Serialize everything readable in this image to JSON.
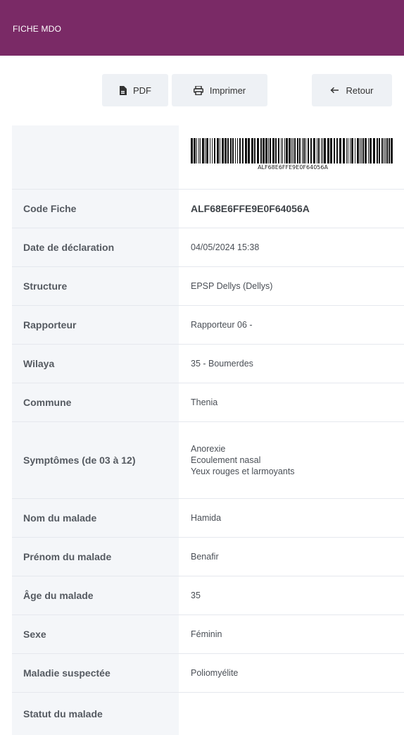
{
  "header": {
    "title": "FICHE MDO"
  },
  "toolbar": {
    "pdf_label": "PDF",
    "print_label": "Imprimer",
    "back_label": "Retour"
  },
  "barcode": {
    "text": "ALF68E6FFE9E0F64056A"
  },
  "fields": [
    {
      "label": "Code Fiche",
      "value": "ALF68E6FFE9E0F64056A"
    },
    {
      "label": "Date de déclaration",
      "value": "04/05/2024 15:38"
    },
    {
      "label": "Structure",
      "value": "EPSP Dellys (Dellys)"
    },
    {
      "label": "Rapporteur",
      "value": "Rapporteur 06 -"
    },
    {
      "label": "Wilaya",
      "value": "35 - Boumerdes"
    },
    {
      "label": "Commune",
      "value": "Thenia"
    },
    {
      "label": "Symptômes (de 03 à 12)",
      "values": [
        "Anorexie",
        "Ecoulement nasal",
        "Yeux rouges et larmoyants"
      ]
    },
    {
      "label": "Nom du malade",
      "value": "Hamida"
    },
    {
      "label": "Prénom du malade",
      "value": "Benafir"
    },
    {
      "label": "Âge du malade",
      "value": "35"
    },
    {
      "label": "Sexe",
      "value": "Féminin"
    },
    {
      "label": "Maladie suspectée",
      "value": "Poliomyélite"
    },
    {
      "label": "Statut du malade",
      "value": ""
    }
  ],
  "colors": {
    "header_bg": "#7a2a66",
    "label_bg": "#f4f6f9",
    "button_bg": "#eef1f5"
  },
  "icons": {
    "pdf": "file-pdf-icon",
    "print": "printer-icon",
    "back": "arrow-left-icon"
  }
}
